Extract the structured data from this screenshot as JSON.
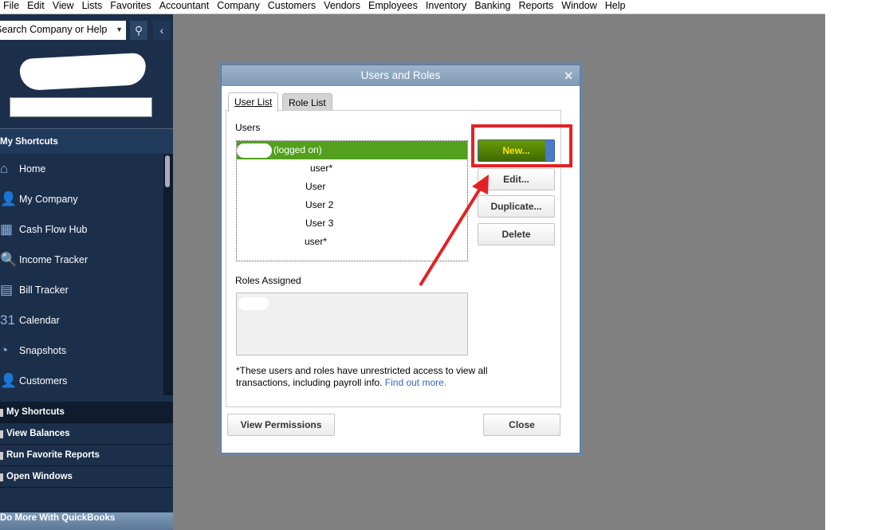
{
  "menu": [
    "File",
    "Edit",
    "View",
    "Lists",
    "Favorites",
    "Accountant",
    "Company",
    "Customers",
    "Vendors",
    "Employees",
    "Inventory",
    "Banking",
    "Reports",
    "Window",
    "Help"
  ],
  "sidebar": {
    "search_placeholder": "Search Company or Help",
    "shortcuts_header": "My Shortcuts",
    "items": [
      {
        "label": "Home",
        "icon": "home-icon",
        "glyph": "⌂"
      },
      {
        "label": "My Company",
        "icon": "my-company-icon",
        "glyph": "👤"
      },
      {
        "label": "Cash Flow Hub",
        "icon": "cash-flow-icon",
        "glyph": "▦"
      },
      {
        "label": "Income Tracker",
        "icon": "income-tracker-icon",
        "glyph": "🔍"
      },
      {
        "label": "Bill Tracker",
        "icon": "bill-tracker-icon",
        "glyph": "▤"
      },
      {
        "label": "Calendar",
        "icon": "calendar-icon",
        "glyph": "31"
      },
      {
        "label": "Snapshots",
        "icon": "snapshots-icon",
        "glyph": "◔"
      },
      {
        "label": "Customers",
        "icon": "customers-icon",
        "glyph": "👤"
      }
    ],
    "bottom": [
      "My Shortcuts",
      "View Balances",
      "Run Favorite Reports",
      "Open Windows"
    ],
    "do_more": "Do More With QuickBooks"
  },
  "dialog": {
    "title": "Users and Roles",
    "tabs": [
      "User List",
      "Role List"
    ],
    "users_label": "Users",
    "users": [
      "(logged on)",
      "user*",
      "User",
      "User 2",
      "User 3",
      "user*"
    ],
    "roles_label": "Roles Assigned",
    "buttons": {
      "new": "New...",
      "edit": "Edit...",
      "duplicate": "Duplicate...",
      "delete": "Delete"
    },
    "note": "*These users and roles have unrestricted access to view all transactions, including payroll info.",
    "link": "Find out more.",
    "view_permissions": "View Permissions",
    "close": "Close"
  },
  "colors": {
    "sidebar": "#1b2f4b",
    "selected_row": "#52a01d",
    "annotation": "#e32124"
  }
}
